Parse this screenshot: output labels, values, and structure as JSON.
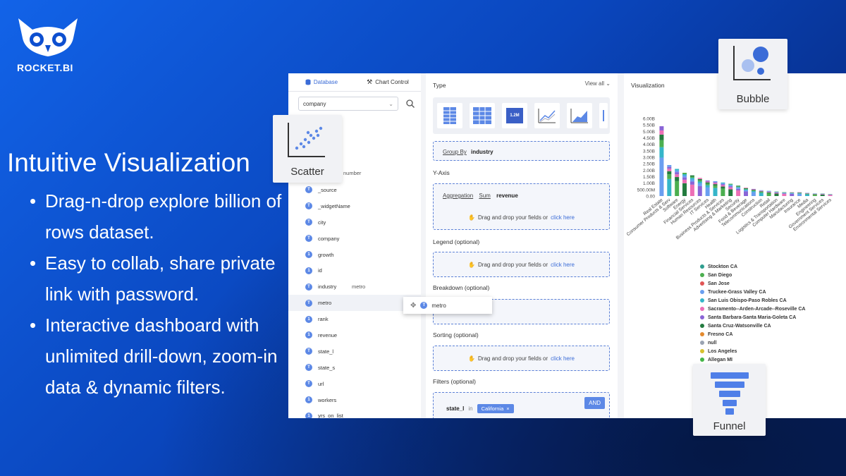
{
  "brand": {
    "name": "ROCKET.BI"
  },
  "headline": "Intuitive Visualization",
  "bullets": [
    "Drag-n-drop explore billion of rows dataset.",
    "Easy to collab, share private link with password.",
    "Interactive dashboard with unlimited drill-down, zoom-in data & dynamic filters."
  ],
  "left_panel": {
    "tabs": [
      "Database",
      "Chart Control"
    ],
    "database_select": "company",
    "partial_field": "number",
    "fields": [
      "_source",
      "_widgetName",
      "city",
      "company",
      "growth",
      "id",
      "industry",
      "metro",
      "rank",
      "revenue",
      "state_l",
      "state_s",
      "url",
      "workers",
      "yrs_on_list"
    ],
    "field_types": [
      "T",
      "T",
      "T",
      "T",
      "1",
      "1",
      "T",
      "T",
      "1",
      "1",
      "T",
      "T",
      "T",
      "1",
      "1"
    ],
    "ghost_label": "metro"
  },
  "config": {
    "type_title": "Type",
    "view_all": "View all",
    "number_tile": "1.2M",
    "group_by_label": "Group By",
    "group_by_value": "industry",
    "yaxis_title": "Y-Axis",
    "aggregation_label": "Aggregation",
    "sum_label": "Sum",
    "yaxis_field": "revenue",
    "legend_title": "Legend (optional)",
    "breakdown_title": "Breakdown (optional)",
    "sorting_title": "Sorting (optional)",
    "filters_title": "Filters (optional)",
    "drag_hint": "Drag and drop your fields or",
    "click_here": "click here",
    "filter_field": "state_l",
    "filter_op": "in",
    "filter_value": "California",
    "and_button": "AND"
  },
  "drag_item": {
    "label": "metro"
  },
  "viz": {
    "title": "Visualization"
  },
  "chart_data": {
    "type": "bar",
    "stacked": true,
    "y_ticks": [
      "0.00",
      "500.00M",
      "1.00B",
      "1.50B",
      "2.00B",
      "2.50B",
      "3.00B",
      "3.50B",
      "4.00B",
      "4.50B",
      "5.00B",
      "5.50B",
      "6.00B"
    ],
    "ylim": [
      0,
      6.0
    ],
    "unit": "B",
    "categories": [
      "Real Estate",
      "Consumer Products & Serv",
      "Software",
      "Energy",
      "Financial Services",
      "Human Resources",
      "IT Services",
      "Health",
      "Business Products & Services",
      "Advertising & Marketing",
      "Security",
      "Food & Beverage",
      "Telecommunications",
      "Construction",
      "Retail",
      "Logistics & Transportation",
      "Computer Hardware",
      "Manufacturing",
      "Insurance",
      "Media",
      "Engineering",
      "Government Services",
      "Environmental Services"
    ],
    "values": [
      5.4,
      2.4,
      2.1,
      1.8,
      1.6,
      1.4,
      1.2,
      1.15,
      1.05,
      0.95,
      0.8,
      0.65,
      0.55,
      0.45,
      0.4,
      0.35,
      0.3,
      0.3,
      0.3,
      0.25,
      0.2,
      0.2,
      0.15
    ],
    "legend": [
      "Stockton CA",
      "San Diego",
      "San Jose",
      "Truckee-Grass Valley CA",
      "San Luis Obispo-Paso Robles CA",
      "Sacramento--Arden-Arcade--Roseville CA",
      "Santa Barbara-Santa Maria-Goleta CA",
      "Santa Cruz-Watsonville CA",
      "Fresno CA",
      "null",
      "Los Angeles",
      "Allegan MI"
    ],
    "legend_colors": [
      "#2f9e8f",
      "#4caf50",
      "#e05555",
      "#6a9ff0",
      "#35b5c9",
      "#ec6fb6",
      "#8a64d6",
      "#237b3f",
      "#e38a2f",
      "#9aa3b2",
      "#d6c12e",
      "#45b649"
    ]
  },
  "cards": {
    "scatter": "Scatter",
    "bubble": "Bubble",
    "funnel": "Funnel"
  },
  "colors": {
    "accent": "#5c88e6",
    "bg_start": "#1263e8",
    "bg_end": "#061f63"
  }
}
